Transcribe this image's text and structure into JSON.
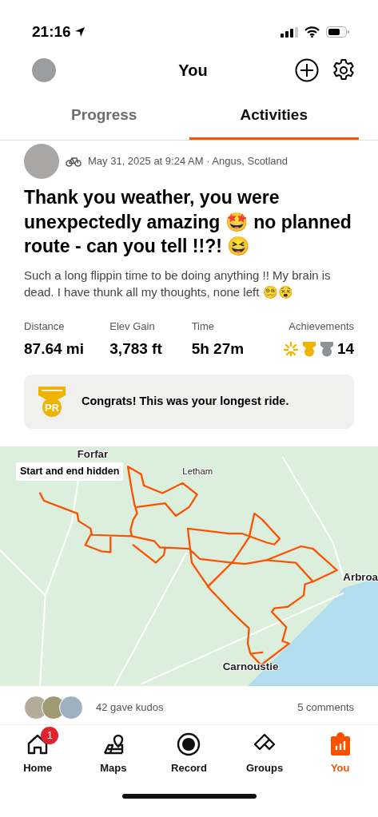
{
  "status_bar": {
    "time": "21:16"
  },
  "header": {
    "title": "You"
  },
  "tabs": [
    {
      "label": "Progress",
      "selected": false
    },
    {
      "label": "Activities",
      "selected": true
    }
  ],
  "activity": {
    "meta": "May 31, 2025 at 9:24 AM · Angus, Scotland",
    "title": "Thank you weather, you were unexpectedly amazing 🤩 no planned route - can you tell !!?! 😆",
    "description": "Such a long flippin time to be doing anything !! My brain is dead. I have thunk all my thoughts, none left 😵‍💫😵",
    "stats": [
      {
        "label": "Distance",
        "value": "87.64 mi"
      },
      {
        "label": "Elev Gain",
        "value": "3,783 ft"
      },
      {
        "label": "Time",
        "value": "5h 27m"
      }
    ],
    "achievements": {
      "label": "Achievements",
      "count": "14"
    },
    "highlight": {
      "badge": "PR",
      "text": "Congrats! This was your longest ride."
    },
    "map": {
      "notice": "Start and end hidden",
      "places": [
        {
          "name": "Forfar",
          "kind": "town"
        },
        {
          "name": "Letham",
          "kind": "village"
        },
        {
          "name": "Arbroa",
          "kind": "town"
        },
        {
          "name": "Carnoustie",
          "kind": "town"
        }
      ]
    },
    "kudos": "42 gave kudos",
    "comments": "5 comments"
  },
  "nav": [
    {
      "label": "Home",
      "selected": false,
      "badge": "1"
    },
    {
      "label": "Maps",
      "selected": false
    },
    {
      "label": "Record",
      "selected": false
    },
    {
      "label": "Groups",
      "selected": false
    },
    {
      "label": "You",
      "selected": true
    }
  ]
}
